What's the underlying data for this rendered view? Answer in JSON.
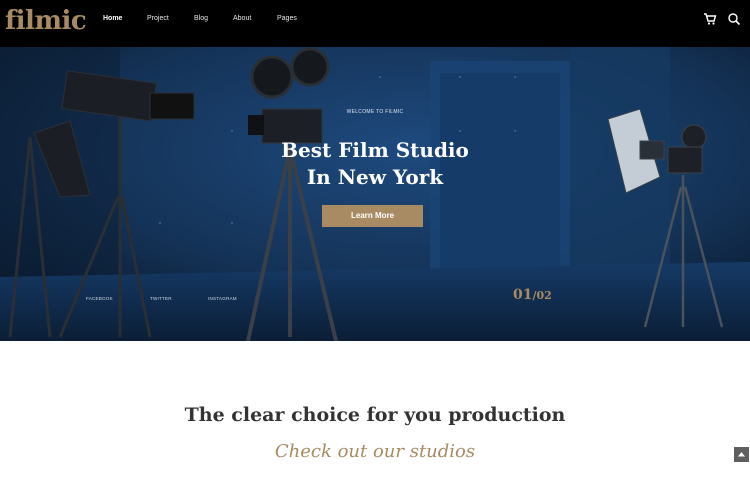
{
  "brand": {
    "logo_text": "filmic",
    "accent": "#a88b63"
  },
  "nav": {
    "items": [
      {
        "label": "Home",
        "active": true
      },
      {
        "label": "Project"
      },
      {
        "label": "Blog"
      },
      {
        "label": "About"
      },
      {
        "label": "Pages"
      }
    ],
    "icons": [
      "cart-icon",
      "search-icon"
    ]
  },
  "hero": {
    "kicker": "WELCOME TO FILMIC",
    "headline_line1": "Best Film Studio",
    "headline_line2": "In New York",
    "cta_label": "Learn More",
    "social": [
      "FACEBOOK",
      "TWITTER",
      "INSTAGRAM"
    ],
    "slide_current": "01",
    "slide_total": "02"
  },
  "section": {
    "title": "The clear choice for you production",
    "subtitle": "Check out our studios"
  },
  "scroll_top_icon": "arrow-up-icon"
}
